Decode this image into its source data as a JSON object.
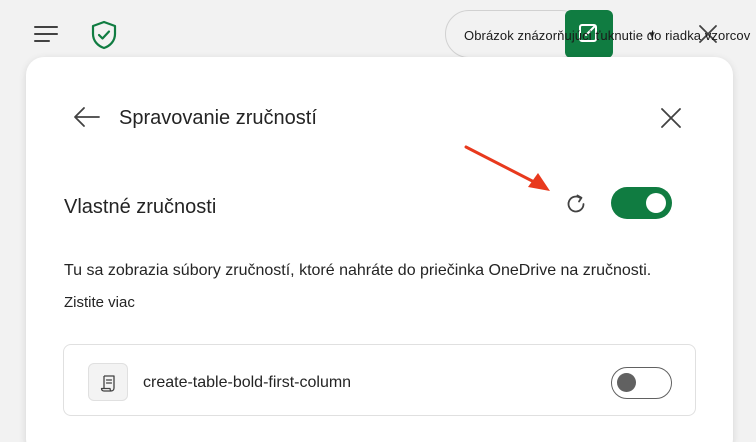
{
  "topbar": {
    "menu_icon": "hamburger-icon",
    "shield_icon": "shield-check-icon",
    "tooltip_text": "Obrázok znázorňujúci ťuknutie do riadka vzorcov",
    "accent": "#107c41"
  },
  "dialog": {
    "title": "Spravovanie zručností",
    "back_icon": "arrow-left-icon",
    "close_icon": "close-icon"
  },
  "custom_skills": {
    "title": "Vlastné zručnosti",
    "refresh_icon": "refresh-icon",
    "enabled": true,
    "description": "Tu sa zobrazia súbory zručností, ktoré nahráte do priečinka OneDrive na zručnosti.",
    "learn_more": "Zistite viac"
  },
  "annotation": {
    "arrow_color": "#e8391d"
  },
  "skills": [
    {
      "name": "create-table-bold-first-column",
      "icon": "script-icon",
      "enabled": false
    }
  ]
}
